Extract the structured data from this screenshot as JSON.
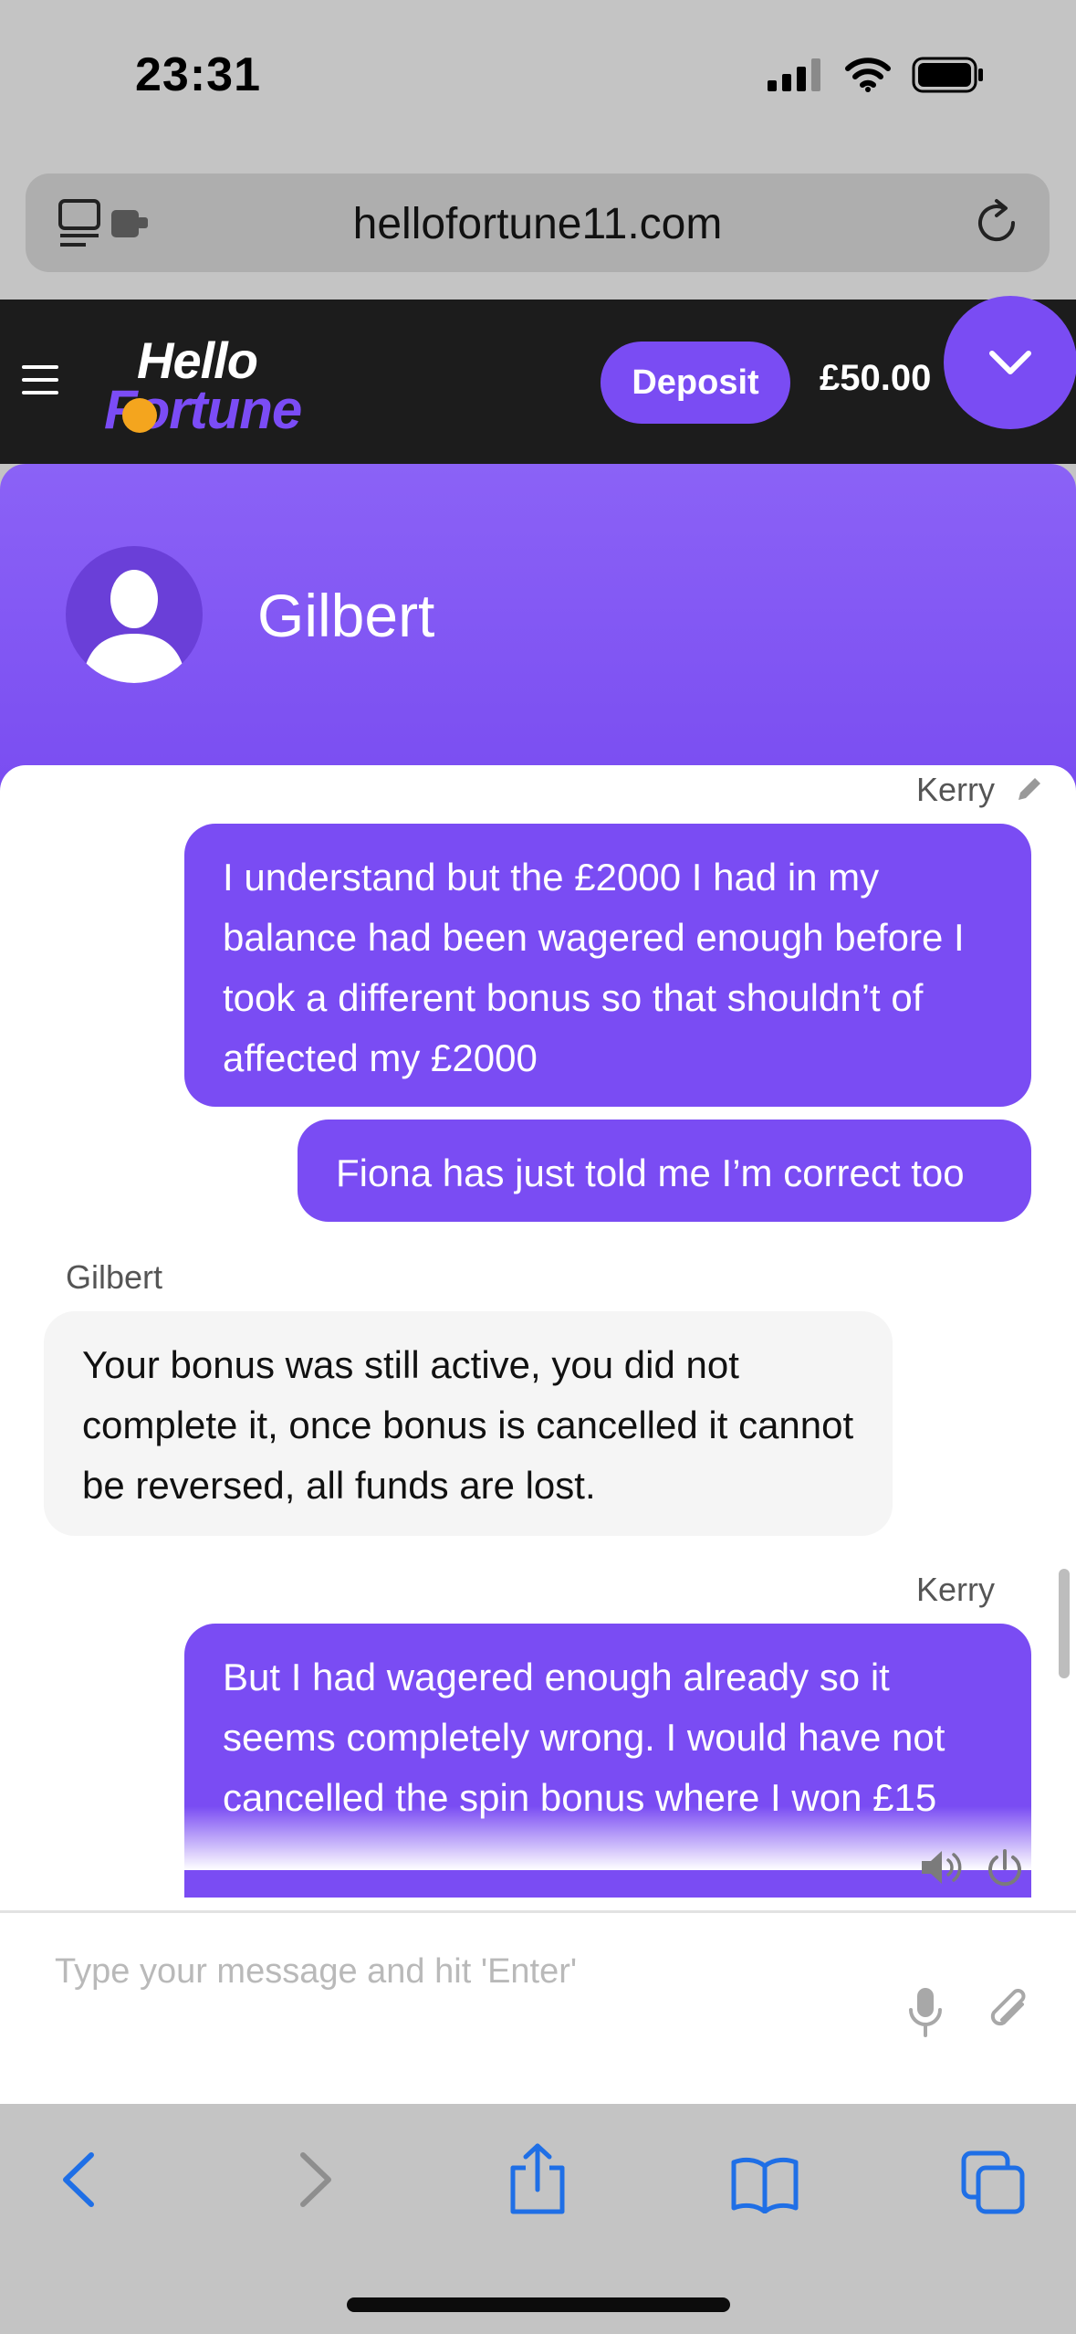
{
  "status_bar": {
    "time": "23:31"
  },
  "browser": {
    "url": "hellofortune11.com"
  },
  "site_header": {
    "logo_line1": "Hello",
    "logo_line2": "Fortune",
    "deposit_label": "Deposit",
    "balance": "£50.00",
    "accent_color": "#7a4cf3"
  },
  "chat": {
    "agent_name": "Gilbert",
    "messages": [
      {
        "sender": "Kerry",
        "from": "user",
        "text": "I understand but the £2000 I had in my balance had been wagered enough before I took a different bonus so that shouldn’t of affected my £2000"
      },
      {
        "sender": "",
        "from": "user",
        "text": "Fiona has just told me I’m correct too"
      },
      {
        "sender": "Gilbert",
        "from": "agent",
        "text": "Your bonus was still active, you did not complete it, once bonus is cancelled it cannot be reversed, all funds are lost."
      },
      {
        "sender": "Kerry",
        "from": "user",
        "text": "But I had wagered enough already so it seems completely wrong. I would have not cancelled the spin bonus where I won £15"
      }
    ],
    "input_placeholder": "Type your message and hit 'Enter'",
    "input_value": ""
  },
  "icons": {
    "status": [
      "cellular-signal-icon",
      "wifi-icon",
      "battery-icon"
    ],
    "browser": [
      "tab-overview-icon",
      "reload-icon"
    ],
    "header": [
      "menu-icon",
      "chevron-down-icon"
    ],
    "chat": [
      "edit-pencil-icon",
      "sound-icon",
      "power-icon",
      "microphone-icon",
      "paperclip-icon"
    ],
    "toolbar": [
      "back-arrow-icon",
      "forward-arrow-icon",
      "share-icon",
      "bookmarks-icon",
      "tabs-icon"
    ]
  }
}
